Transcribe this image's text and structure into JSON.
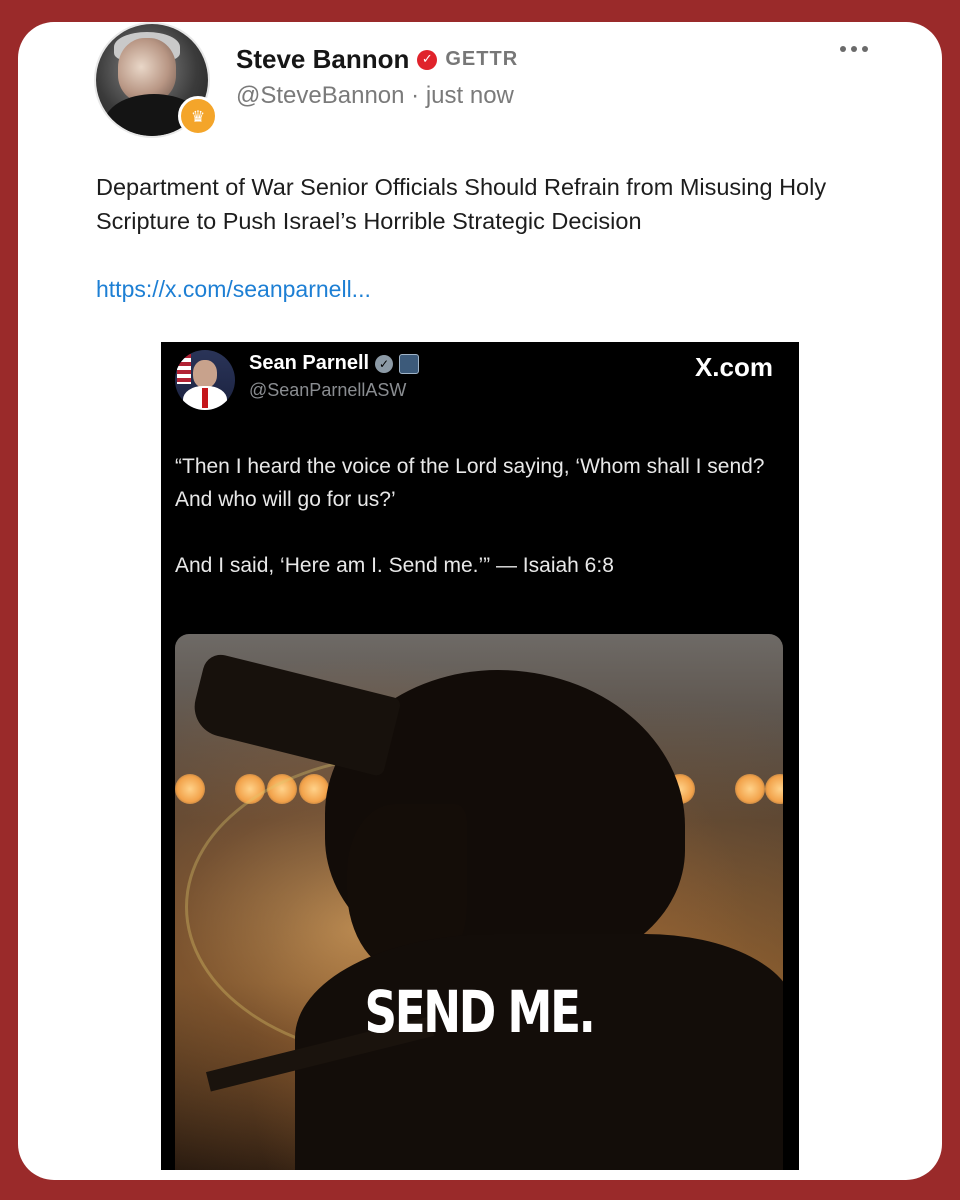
{
  "post": {
    "author_name": "Steve Bannon",
    "platform": "GETTR",
    "handle": "@SteveBannon",
    "separator": "·",
    "time": "just now",
    "text": "Department of War Senior Officials Should Refrain from Misusing Holy Scripture to Push Israel’s Horrible Strategic Decision",
    "link": "https://x.com/seanparnell..."
  },
  "embed": {
    "author_name": "Sean Parnell",
    "handle": "@SeanParnellASW",
    "site": "X.com",
    "quote_line1": "“Then I heard the voice of the Lord saying, ‘Whom shall I send? And who will go for us?’",
    "quote_line2": "And I said, ‘Here am I. Send me.’” — Isaiah 6:8",
    "image_caption": "SEND ME."
  },
  "icons": {
    "verified": "verified-badge-icon",
    "more": "more-options-icon",
    "crown": "crown-badge-icon"
  },
  "colors": {
    "background": "#9a2a2a",
    "link": "#1d7fd4",
    "verified": "#e0232b",
    "badge": "#f4a52a"
  }
}
